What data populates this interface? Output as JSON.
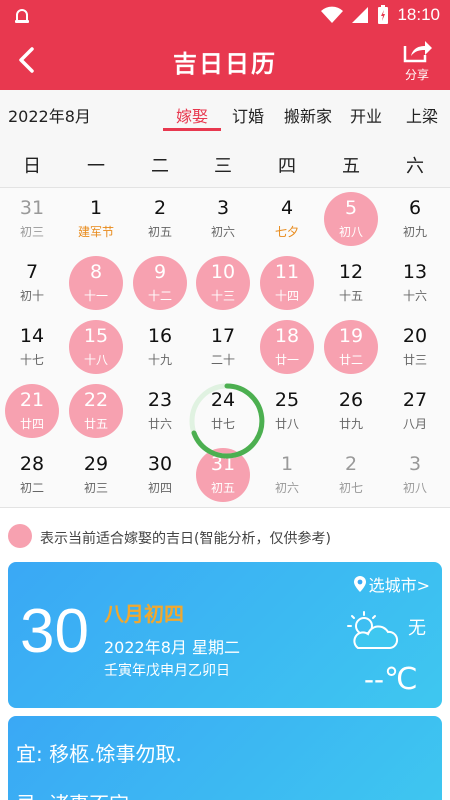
{
  "status_bar": {
    "time": "18:10"
  },
  "header": {
    "title": "吉日日历",
    "share_label": "分享"
  },
  "tabs_row": {
    "month": "2022年8月",
    "tabs": [
      {
        "label": "嫁娶",
        "active": true
      },
      {
        "label": "订婚",
        "active": false
      },
      {
        "label": "搬新家",
        "active": false
      },
      {
        "label": "开业",
        "active": false
      },
      {
        "label": "上梁",
        "active": false
      }
    ]
  },
  "weekdays": [
    "日",
    "一",
    "二",
    "三",
    "四",
    "五",
    "六"
  ],
  "calendar": {
    "rows": [
      [
        {
          "day": "31",
          "lunar": "初三",
          "other": true
        },
        {
          "day": "1",
          "lunar": "建军节",
          "festival": true
        },
        {
          "day": "2",
          "lunar": "初五"
        },
        {
          "day": "3",
          "lunar": "初六"
        },
        {
          "day": "4",
          "lunar": "七夕",
          "festival": true
        },
        {
          "day": "5",
          "lunar": "初八",
          "lucky": true
        },
        {
          "day": "6",
          "lunar": "初九"
        }
      ],
      [
        {
          "day": "7",
          "lunar": "初十"
        },
        {
          "day": "8",
          "lunar": "十一",
          "lucky": true
        },
        {
          "day": "9",
          "lunar": "十二",
          "lucky": true
        },
        {
          "day": "10",
          "lunar": "十三",
          "lucky": true
        },
        {
          "day": "11",
          "lunar": "十四",
          "lucky": true
        },
        {
          "day": "12",
          "lunar": "十五"
        },
        {
          "day": "13",
          "lunar": "十六"
        }
      ],
      [
        {
          "day": "14",
          "lunar": "十七"
        },
        {
          "day": "15",
          "lunar": "十八",
          "lucky": true
        },
        {
          "day": "16",
          "lunar": "十九"
        },
        {
          "day": "17",
          "lunar": "二十"
        },
        {
          "day": "18",
          "lunar": "廿一",
          "lucky": true
        },
        {
          "day": "19",
          "lunar": "廿二",
          "lucky": true
        },
        {
          "day": "20",
          "lunar": "廿三"
        }
      ],
      [
        {
          "day": "21",
          "lunar": "廿四",
          "lucky": true
        },
        {
          "day": "22",
          "lunar": "廿五",
          "lucky": true
        },
        {
          "day": "23",
          "lunar": "廿六"
        },
        {
          "day": "24",
          "lunar": "廿七",
          "today": true
        },
        {
          "day": "25",
          "lunar": "廿八"
        },
        {
          "day": "26",
          "lunar": "廿九"
        },
        {
          "day": "27",
          "lunar": "八月"
        }
      ],
      [
        {
          "day": "28",
          "lunar": "初二"
        },
        {
          "day": "29",
          "lunar": "初三"
        },
        {
          "day": "30",
          "lunar": "初四"
        },
        {
          "day": "31",
          "lunar": "初五",
          "lucky": true
        },
        {
          "day": "1",
          "lunar": "初六",
          "other": true
        },
        {
          "day": "2",
          "lunar": "初七",
          "other": true
        },
        {
          "day": "3",
          "lunar": "初八",
          "other": true
        }
      ]
    ]
  },
  "legend": {
    "text": "表示当前适合嫁娶的吉日(智能分析，仅供参考)"
  },
  "day_card": {
    "day": "30",
    "lunar_title": "八月初四",
    "date_line": "2022年8月 星期二",
    "ganzhi": "壬寅年戊申月乙卯日",
    "city": "选城市>",
    "wind": "无",
    "temp": "--℃"
  },
  "yiji": {
    "yi": "宜: 移柩.馀事勿取.",
    "ji": "忌: 诸事不宜"
  },
  "colors": {
    "primary": "#e8384f",
    "lucky": "#f7a1b0",
    "card": "#3aa8f5",
    "festival": "#e88a1a",
    "today_ring": "#4caf50"
  }
}
